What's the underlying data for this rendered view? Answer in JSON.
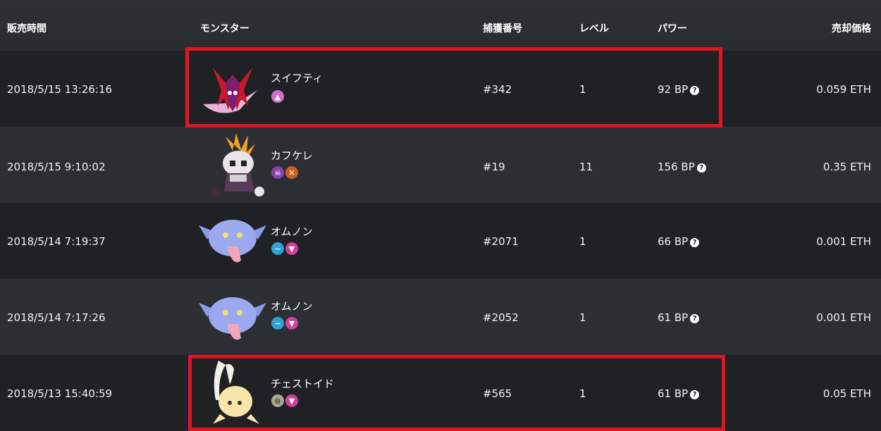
{
  "header": {
    "time": "販売時間",
    "monster": "モンスター",
    "capture": "捕獲番号",
    "level": "レベル",
    "power": "パワー",
    "price": "売却価格"
  },
  "rows": [
    {
      "time": "2018/5/15 13:26:16",
      "name": "スイフティ",
      "capture": "#342",
      "level": "1",
      "power": "92 BP",
      "price": "0.059 ETH",
      "types": [
        "pink-triangle-type"
      ],
      "highlighted": true
    },
    {
      "time": "2018/5/15 9:10:02",
      "name": "カフケレ",
      "capture": "#19",
      "level": "11",
      "power": "156 BP",
      "price": "0.35 ETH",
      "types": [
        "purple-skull-type",
        "orange-cross-type"
      ],
      "highlighted": false
    },
    {
      "time": "2018/5/14 7:19:37",
      "name": "オムノン",
      "capture": "#2071",
      "level": "1",
      "power": "66 BP",
      "price": "0.001 ETH",
      "types": [
        "blue-wave-type",
        "pink-gem-type"
      ],
      "highlighted": false
    },
    {
      "time": "2018/5/14 7:17:26",
      "name": "オムノン",
      "capture": "#2052",
      "level": "1",
      "power": "61 BP",
      "price": "0.001 ETH",
      "types": [
        "blue-wave-type",
        "pink-gem-type"
      ],
      "highlighted": false
    },
    {
      "time": "2018/5/13 15:40:59",
      "name": "チェストイド",
      "capture": "#565",
      "level": "1",
      "power": "61 BP",
      "price": "0.05 ETH",
      "types": [
        "gray-circle-type",
        "pink-gem-type"
      ],
      "highlighted": true
    }
  ],
  "colors": {
    "highlight": "#e11520",
    "row_dark": "#1f2124",
    "row_light": "#2b2e32"
  }
}
